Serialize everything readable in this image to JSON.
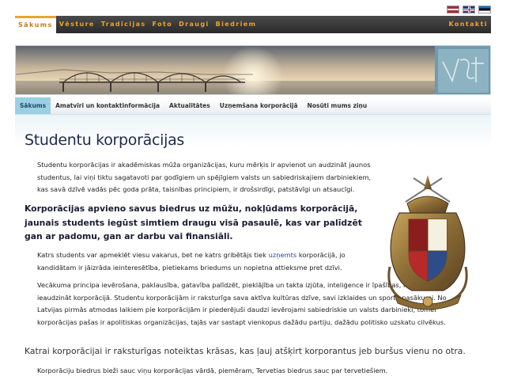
{
  "languages": [
    "lv",
    "en",
    "ee"
  ],
  "topnav": {
    "items": [
      "Sākums",
      "Vēsture",
      "Tradīcijas",
      "Foto",
      "Draugi",
      "Biedriem"
    ],
    "right": "Kontakti"
  },
  "tabs": [
    "Sākums",
    "Amatvīri un kontaktinformācija",
    "Aktualitātes",
    "Uzņemšana korporācijā",
    "Nosūti mums ziņu"
  ],
  "main": {
    "title": "Studentu korporācijas",
    "p1": "Studentu korporācijas ir akadēmiskas mūža organizācijas, kuru mērķis ir apvienot un audzināt jaunos studentus, lai viņi tiktu sagatavoti par godīgiem un spējīgiem valsts un sabiedriskajiem darbiniekiem, kas savā dzīvē vadās pēc goda prāta, taisnības principiem, ir drošsirdīgi, patstāvīgi un atsaucīgi.",
    "p2": "Korporācijas apvieno savus biedrus uz mūžu, nokļūdams korporācijā, jaunais students iegūst simtiem draugu visā pasaulē, kas var palīdzēt gan ar padomu, gan ar darbu vai finansiāli.",
    "p3_before": "Katrs students var apmeklēt viesu vakarus, bet ne katrs gribētājs tiek ",
    "p3_link": "uzņemts",
    "p3_after": " korporācijā, jo kandidātam ir jāizrāda ieinteresētība, pietiekams briedums un nopietna attieksme pret dzīvi.",
    "p4": "Vecākuma principa ievērošana, paklausība, gatavība palīdzēt, pieklājība un takta izjūta, inteliģence ir īpašības, kuras censās ieaudzināt korporācijā. Studentu korporācijām ir raksturīga sava aktīva kultūras dzīve, savi izklaides un sporta pasākumi. No Latvijas pirmās atmodas laikiem pie korporācijām ir piederējuši daudzi ievērojami sabiedriskie un valsts darbinieki, tomēr korporācijas pašas ir apolitiskas organizācijas, tajās var sastapt vienkopus dažādu partiju, dažādu politisko uzskatu cilvēkus.",
    "p5": "Katrai korporācijai ir raksturīgas noteiktas krāsas, kas ļauj atšķirt korporantus jeb buršus vienu no otra.",
    "p6": "Korporāciju biedrus bieži sauc viņu korporācijas vārdā, piemēram, Tervetias biedrus sauc par tervetiešiem."
  }
}
